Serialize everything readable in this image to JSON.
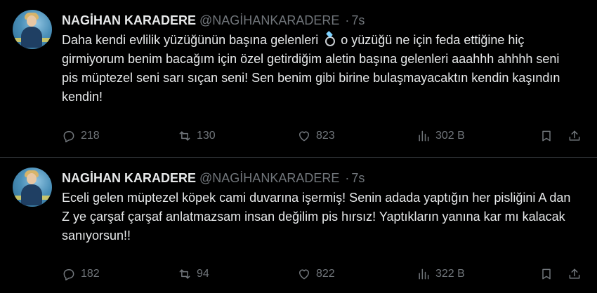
{
  "tweets": [
    {
      "author_name": "NAGİHAN KARADERE",
      "handle": "@NAGİHANKARADERE",
      "separator": "·",
      "time": "7s",
      "text_before_emoji": "Daha kendi evlilik yüzüğünün başına gelenleri",
      "emoji": "ring",
      "text_after_emoji": "o yüzüğü ne için feda ettiğine hiç girmiyorum benim bacağım için özel getirdiğim aletin başına gelenleri aaahhh ahhhh seni pis müptezel seni sarı sıçan seni! Sen benim gibi birine bulaşmayacaktın kendin kaşındın kendin!",
      "replies": "218",
      "reposts": "130",
      "likes": "823",
      "views": "302 B"
    },
    {
      "author_name": "NAGİHAN KARADERE",
      "handle": "@NAGİHANKARADERE",
      "separator": "·",
      "time": "7s",
      "text": "Eceli gelen müptezel köpek cami duvarına işermiş! Senin adada yaptığın her pisliğini A dan Z ye  çarşaf çarşaf anlatmazsam insan değilim pis hırsız! Yaptıkların yanına kar mı kalacak sanıyorsun!!",
      "replies": "182",
      "reposts": "94",
      "likes": "822",
      "views": "322 B"
    }
  ],
  "icons": {
    "reply": "reply-icon",
    "repost": "repost-icon",
    "like": "heart-icon",
    "views": "views-icon",
    "bookmark": "bookmark-icon",
    "share": "share-icon"
  },
  "colors": {
    "background": "#000000",
    "text": "#e7e9ea",
    "muted": "#71767b",
    "divider": "#2f3336"
  }
}
